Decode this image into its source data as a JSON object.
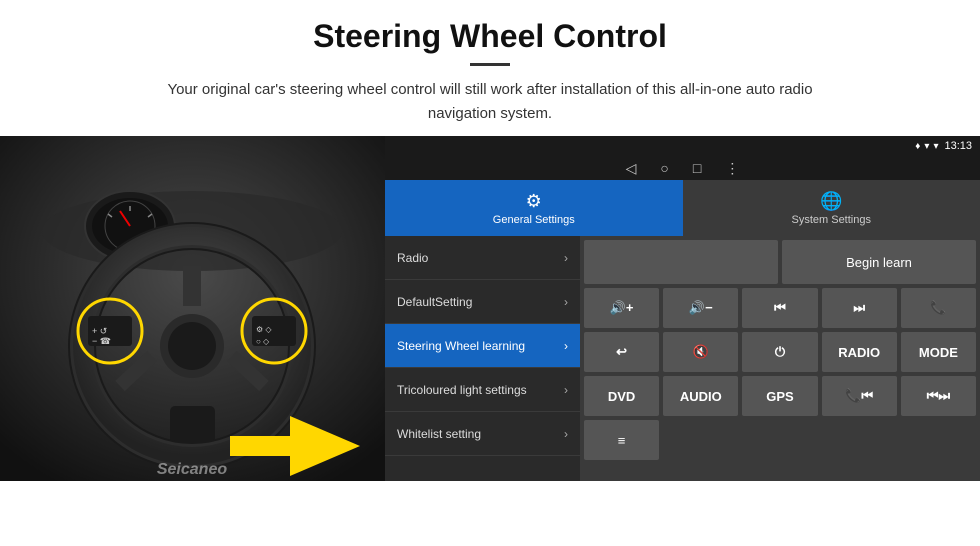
{
  "header": {
    "title": "Steering Wheel Control",
    "subtitle": "Your original car's steering wheel control will still work after installation of this all-in-one auto radio navigation system."
  },
  "android_ui": {
    "status_bar": {
      "time": "13:13",
      "wifi_icon": "wifi",
      "signal_icon": "signal",
      "location_icon": "loc"
    },
    "nav_bar": {
      "back": "◁",
      "home": "○",
      "recent": "□",
      "menu": "⋮"
    },
    "tabs": [
      {
        "label": "General Settings",
        "icon": "⚙",
        "active": true
      },
      {
        "label": "System Settings",
        "icon": "🌐",
        "active": false
      }
    ],
    "menu_items": [
      {
        "label": "Radio",
        "active": false
      },
      {
        "label": "DefaultSetting",
        "active": false
      },
      {
        "label": "Steering Wheel learning",
        "active": true
      },
      {
        "label": "Tricoloured light settings",
        "active": false
      },
      {
        "label": "Whitelist setting",
        "active": false
      }
    ],
    "controls": {
      "begin_learn": "Begin learn",
      "row1": [
        "🔊+",
        "🔊−",
        "⏮",
        "⏭",
        "📞"
      ],
      "row2": [
        "↩",
        "🔇",
        "⏻",
        "RADIO",
        "MODE"
      ],
      "row3": [
        "DVD",
        "AUDIO",
        "GPS",
        "📞⏮",
        "⏮⏭"
      ],
      "row4_icon": "≡"
    }
  },
  "watermark": "Seicaneo"
}
